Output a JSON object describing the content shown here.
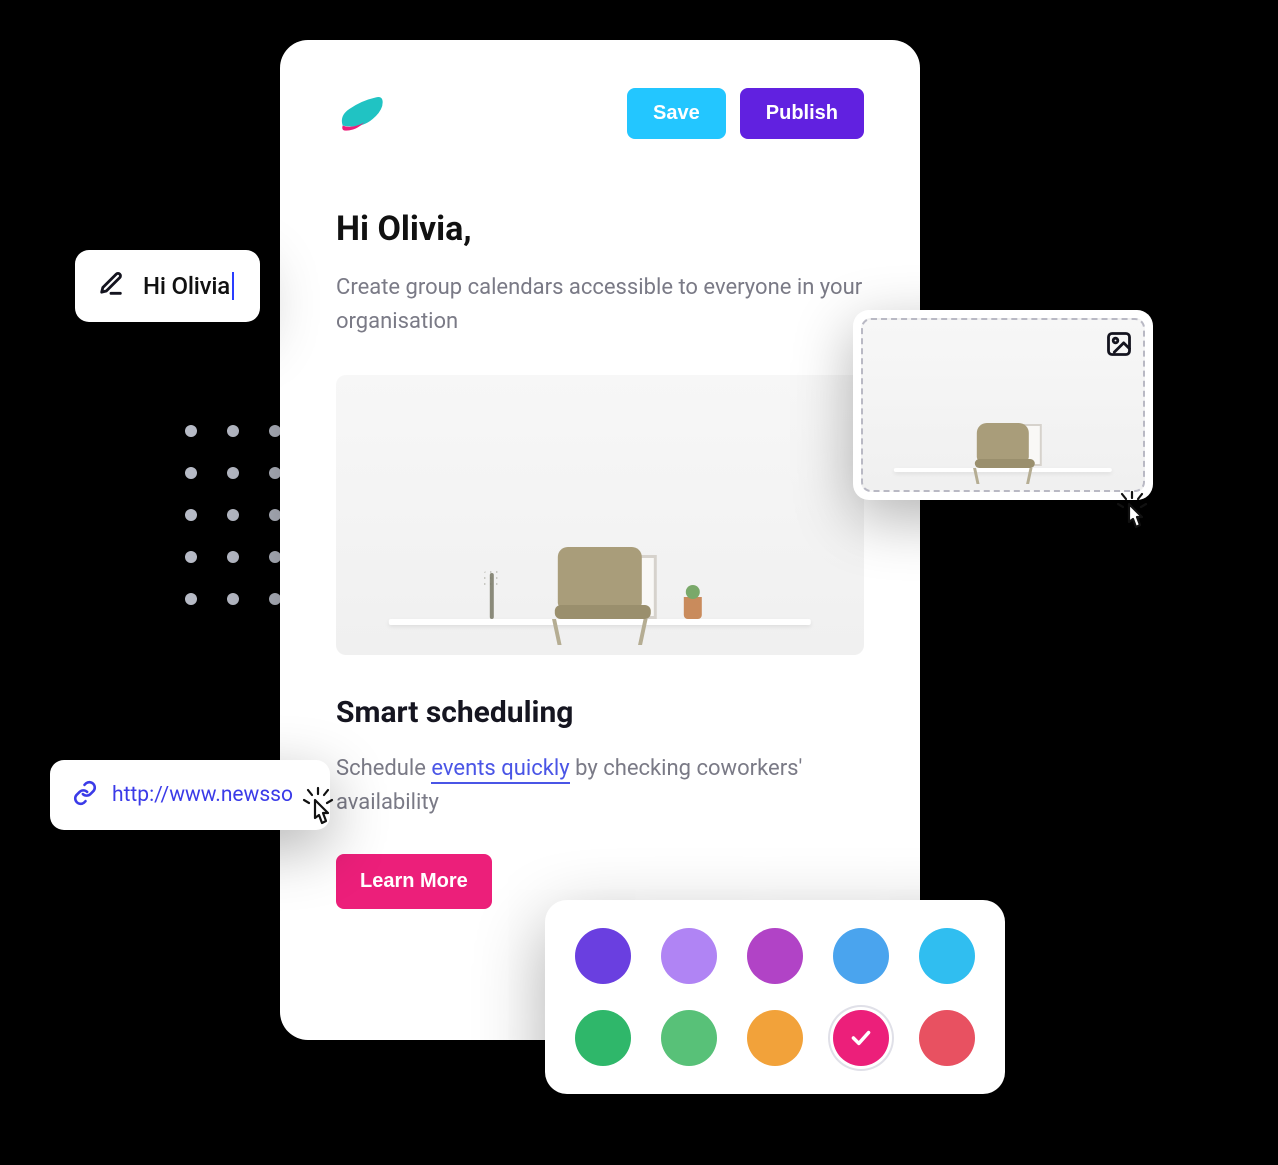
{
  "header": {
    "save_label": "Save",
    "publish_label": "Publish"
  },
  "body": {
    "greeting": "Hi Olivia,",
    "intro": "Create group calendars accessible to everyone in your organisation",
    "section_title": "Smart scheduling",
    "section_text_pre": "Schedule ",
    "section_link": "events quickly",
    "section_text_post": " by checking coworkers' availability",
    "cta_label": "Learn More"
  },
  "edit_pill": {
    "value": "Hi Olivia"
  },
  "link_pill": {
    "url": "http://www.newsso"
  },
  "palette": {
    "colors": [
      "#6a3fe0",
      "#b084f4",
      "#b143c6",
      "#4aa4ee",
      "#30bef0",
      "#2fb76a",
      "#58c178",
      "#f2a23a",
      "#ec1f7a",
      "#e85161"
    ],
    "selected_index": 8
  },
  "colors": {
    "save": "#23c6ff",
    "publish": "#6121e0",
    "cta": "#ec1f7a",
    "link": "#4a55e6"
  }
}
